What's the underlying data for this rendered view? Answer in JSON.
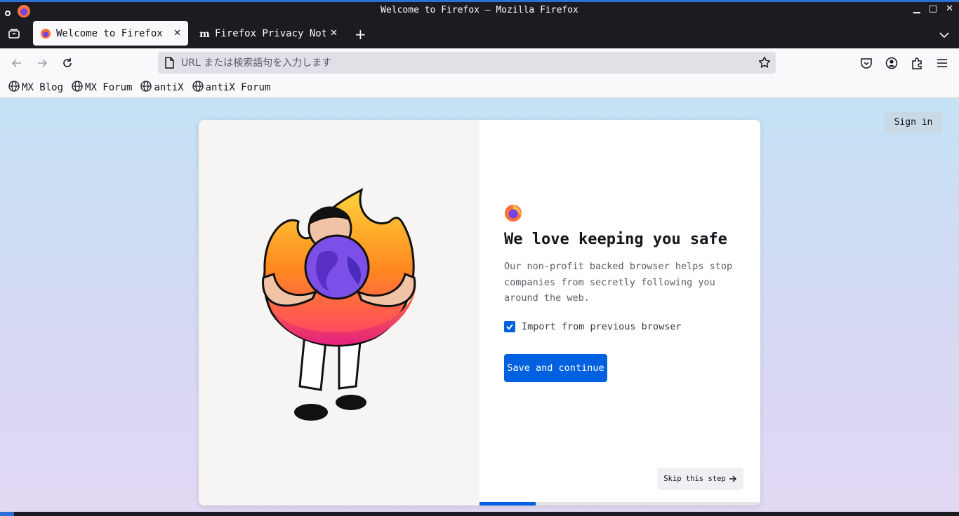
{
  "window": {
    "title": "Welcome to Firefox — Mozilla Firefox",
    "controls": [
      "minimize",
      "maximize",
      "close"
    ]
  },
  "tabs": [
    {
      "label": "Welcome to Firefox",
      "active": true,
      "icon": "firefox-icon"
    },
    {
      "label": "Firefox Privacy Notice",
      "active": false,
      "icon": "mozilla-m-icon"
    }
  ],
  "urlbar": {
    "placeholder": "URL または検索語句を入力します",
    "value": ""
  },
  "bookmarks": [
    {
      "label": "MX Blog"
    },
    {
      "label": "MX Forum"
    },
    {
      "label": "antiX"
    },
    {
      "label": "antiX Forum"
    }
  ],
  "page": {
    "signin_label": "Sign in",
    "heading": "We love keeping you safe",
    "description": "Our non-profit backed browser helps stop companies from secretly following you around the web.",
    "import_label": "Import from previous browser",
    "import_checked": true,
    "primary_button": "Save and continue",
    "skip_button": "Skip this step",
    "progress_fraction": 0.2
  },
  "colors": {
    "accent": "#0061e0",
    "chrome_dark": "#1c1b22",
    "toolbar": "#f9f9fb"
  }
}
